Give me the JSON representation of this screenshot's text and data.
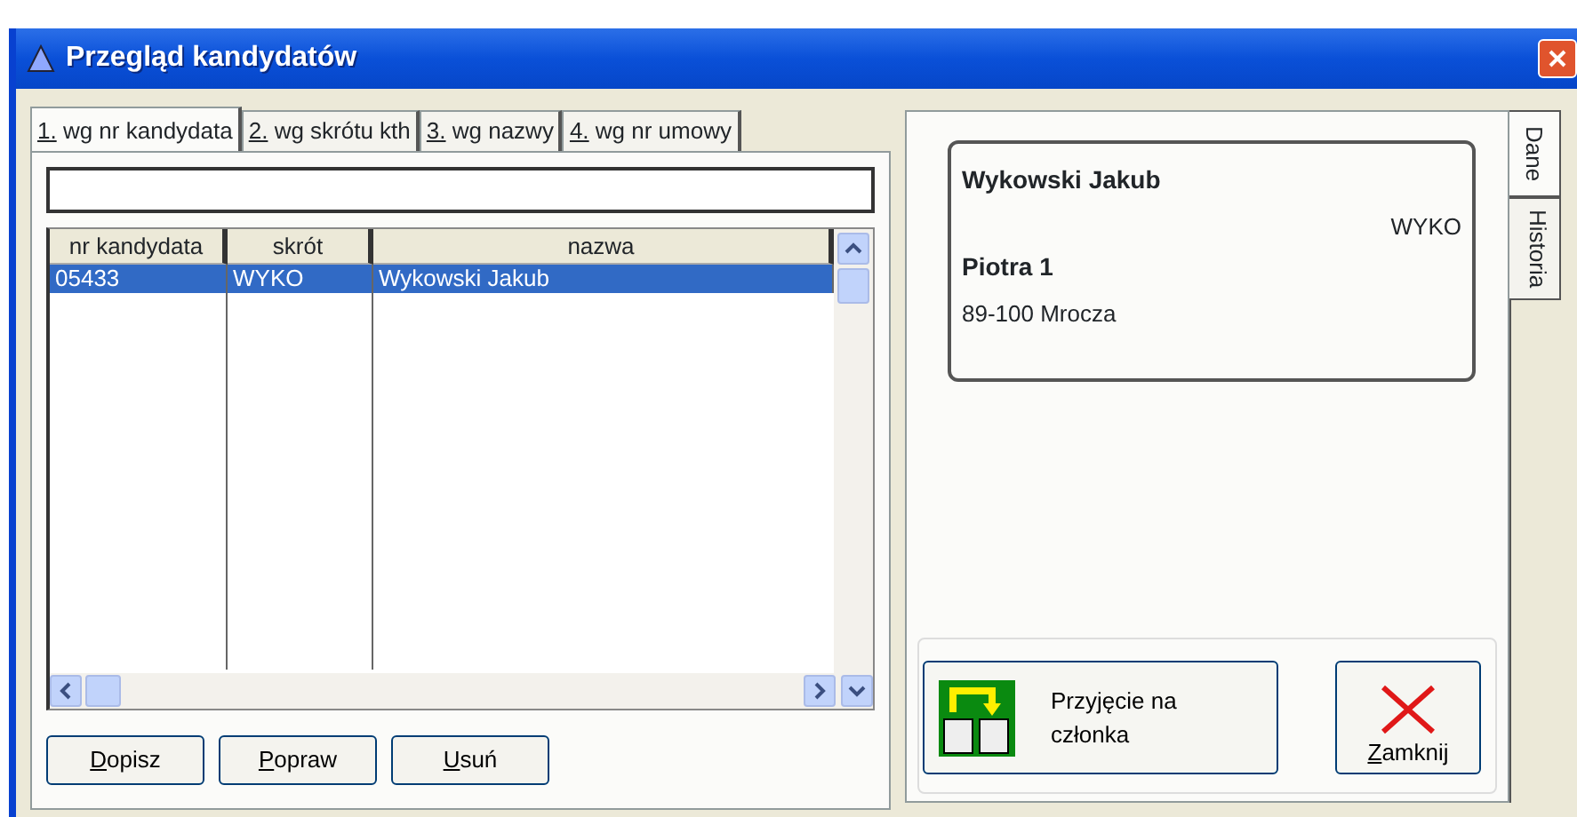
{
  "window": {
    "title": "Przegląd kandydatów"
  },
  "tabs": [
    {
      "label": "1. wg nr kandydata",
      "selected": true
    },
    {
      "label": "2. wg skrótu kth",
      "selected": false
    },
    {
      "label": "3. wg nazwy",
      "selected": false
    },
    {
      "label": "4. wg nr umowy",
      "selected": false
    }
  ],
  "table": {
    "columns": [
      "nr kandydata",
      "skrót",
      "nazwa"
    ],
    "rows": [
      {
        "cells": [
          "05433",
          "WYKO",
          "Wykowski Jakub"
        ],
        "selected": true
      }
    ]
  },
  "list_buttons": [
    "Dopisz",
    "Popraw",
    "Usuń"
  ],
  "details": {
    "name": "Wykowski Jakub",
    "code": "WYKO",
    "street": "Piotra 1",
    "city": "89-100 Mrocza"
  },
  "side_tabs": [
    {
      "label": "Dane",
      "selected": true
    },
    {
      "label": "Historia",
      "selected": false
    }
  ],
  "actions": [
    {
      "label": "Przyjęcie na członka",
      "kind": "admit"
    },
    {
      "label": "Zamknij",
      "kind": "close"
    }
  ]
}
